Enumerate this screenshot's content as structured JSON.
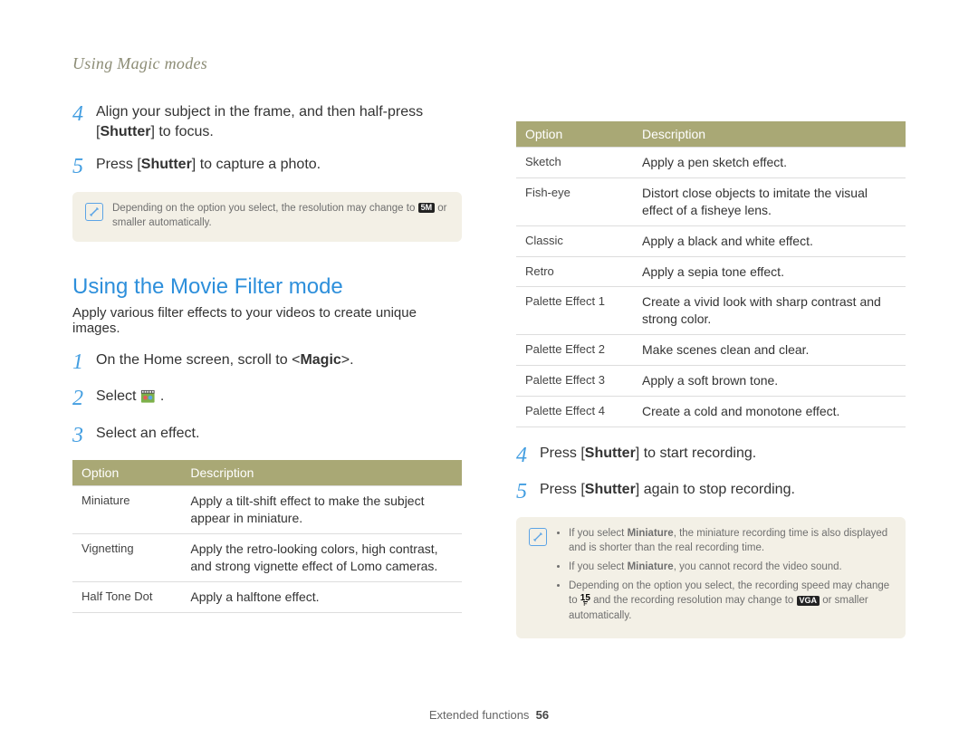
{
  "header": {
    "breadcrumb": "Using Magic modes"
  },
  "left": {
    "steps_top": [
      {
        "num": "4",
        "parts": [
          "Align your subject in the frame, and then half-press [",
          {
            "bold": "Shutter"
          },
          "] to focus."
        ]
      },
      {
        "num": "5",
        "parts": [
          "Press [",
          {
            "bold": "Shutter"
          },
          "] to capture a photo."
        ]
      }
    ],
    "note1": {
      "prefix": "Depending on the option you select, the resolution may change to ",
      "badge": "5M",
      "suffix": " or smaller automatically."
    },
    "heading": "Using the Movie Filter mode",
    "subhead": "Apply various filter effects to your videos to create unique images.",
    "steps_bottom": [
      {
        "num": "1",
        "parts": [
          "On the Home screen, scroll to <",
          {
            "bold": "Magic"
          },
          ">."
        ]
      },
      {
        "num": "2",
        "parts": [
          "Select ",
          {
            "icon": "movie-filter"
          },
          "."
        ]
      },
      {
        "num": "3",
        "parts": [
          "Select an effect."
        ]
      }
    ],
    "table": {
      "headers": [
        "Option",
        "Description"
      ],
      "rows": [
        [
          "Miniature",
          "Apply a tilt-shift effect to make the subject appear in miniature."
        ],
        [
          "Vignetting",
          "Apply the retro-looking colors, high contrast, and strong vignette effect of Lomo cameras."
        ],
        [
          "Half Tone Dot",
          "Apply a halftone effect."
        ]
      ]
    }
  },
  "right": {
    "table": {
      "headers": [
        "Option",
        "Description"
      ],
      "rows": [
        [
          "Sketch",
          "Apply a pen sketch effect."
        ],
        [
          "Fish-eye",
          "Distort close objects to imitate the visual effect of a fisheye lens."
        ],
        [
          "Classic",
          "Apply a black and white effect."
        ],
        [
          "Retro",
          "Apply a sepia tone effect."
        ],
        [
          "Palette Effect 1",
          "Create a vivid look with sharp contrast and strong color."
        ],
        [
          "Palette Effect 2",
          "Make scenes clean and clear."
        ],
        [
          "Palette Effect 3",
          "Apply a soft brown tone."
        ],
        [
          "Palette Effect 4",
          "Create a cold and monotone effect."
        ]
      ]
    },
    "steps": [
      {
        "num": "4",
        "parts": [
          "Press [",
          {
            "bold": "Shutter"
          },
          "] to start recording."
        ]
      },
      {
        "num": "5",
        "parts": [
          "Press [",
          {
            "bold": "Shutter"
          },
          "] again to stop recording."
        ]
      }
    ],
    "note2": {
      "bullets": [
        [
          "If you select ",
          {
            "bold": "Miniature"
          },
          ", the miniature recording time is also displayed and is shorter than the real recording time."
        ],
        [
          "If you select ",
          {
            "bold": "Miniature"
          },
          ", you cannot record the video sound."
        ],
        [
          "Depending on the option you select, the recording speed may change to ",
          {
            "icon": "fps",
            "value": "15"
          },
          " and the recording resolution may change to ",
          {
            "icon": "vga",
            "value": "VGA"
          },
          " or smaller automatically."
        ]
      ]
    }
  },
  "footer": {
    "section": "Extended functions",
    "page": "56"
  }
}
